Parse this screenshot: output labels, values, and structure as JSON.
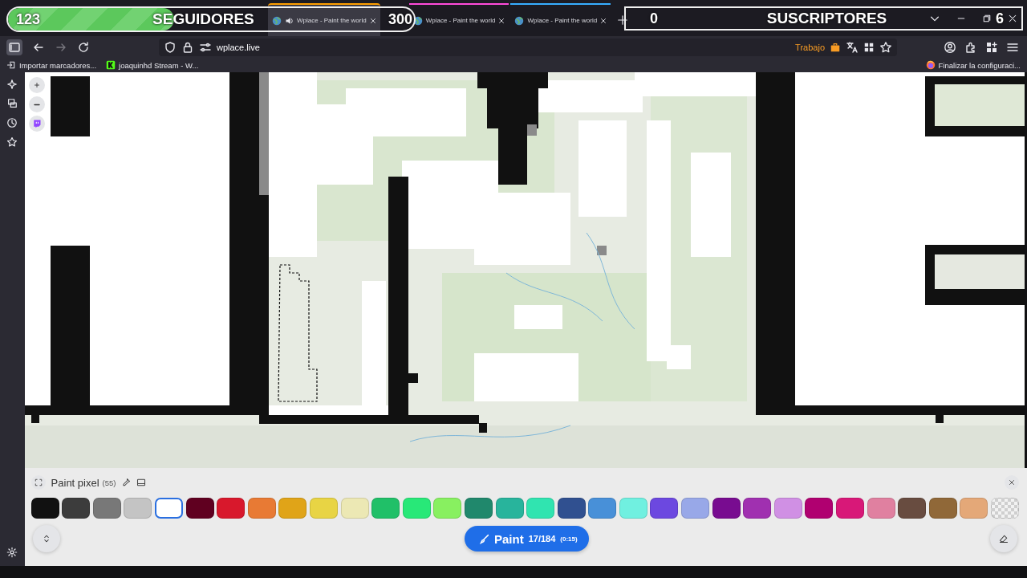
{
  "overlays": {
    "followers": {
      "current": "123",
      "label": "SEGUIDORES",
      "goal": "300",
      "level": 0.41
    },
    "subscribers": {
      "current": "0",
      "label": "SUSCRIPTORES",
      "goal": "6"
    }
  },
  "tabs": [
    {
      "title": "Wplace - Paint the world",
      "selected": true,
      "audio": true,
      "color": "#ff9f00"
    },
    {
      "title": "Wplace - Paint the world",
      "selected": false,
      "audio": false,
      "color": "#ff4bda"
    },
    {
      "title": "Wplace - Paint the world",
      "selected": false,
      "audio": false,
      "color": "#37adff"
    }
  ],
  "navbar": {
    "url": "wplace.live",
    "container": "Trabajo"
  },
  "bookmarks": [
    {
      "label": "Importar marcadores...",
      "kind": "import"
    },
    {
      "label": "joaquinhd Stream - W...",
      "kind": "site"
    }
  ],
  "bookmarks_right": {
    "label": "Finalizar la configuraci..."
  },
  "paint_panel": {
    "title": "Paint pixel",
    "count": "(55)",
    "colors": [
      {
        "color": "#111111",
        "selected": false
      },
      {
        "color": "#3c3c3c",
        "selected": false
      },
      {
        "color": "#787878",
        "selected": false
      },
      {
        "color": "#c4c4c4",
        "selected": false
      },
      {
        "color": "#ffffff",
        "selected": true
      },
      {
        "color": "#600020",
        "selected": false
      },
      {
        "color": "#d8182c",
        "selected": false
      },
      {
        "color": "#e87a34",
        "selected": false
      },
      {
        "color": "#e0a418",
        "selected": false
      },
      {
        "color": "#e8d444",
        "selected": false
      },
      {
        "color": "#ece8b4",
        "selected": false
      },
      {
        "color": "#20c068",
        "selected": false
      },
      {
        "color": "#28e878",
        "selected": false
      },
      {
        "color": "#88f060",
        "selected": false
      },
      {
        "color": "#20886c",
        "selected": false
      },
      {
        "color": "#28b49c",
        "selected": false
      },
      {
        "color": "#30e4b0",
        "selected": false
      },
      {
        "color": "#305090",
        "selected": false
      },
      {
        "color": "#4890d8",
        "selected": false
      },
      {
        "color": "#70f0e0",
        "selected": false
      },
      {
        "color": "#6c48e0",
        "selected": false
      },
      {
        "color": "#98a8e8",
        "selected": false
      },
      {
        "color": "#780c90",
        "selected": false
      },
      {
        "color": "#a030b0",
        "selected": false
      },
      {
        "color": "#d090e4",
        "selected": false
      },
      {
        "color": "#b00070",
        "selected": false
      },
      {
        "color": "#d81878",
        "selected": false
      },
      {
        "color": "#e080a0",
        "selected": false
      },
      {
        "color": "#684c40",
        "selected": false
      },
      {
        "color": "#906838",
        "selected": false
      },
      {
        "color": "#e4a878",
        "selected": false
      },
      {
        "kind": "transparent",
        "selected": false
      }
    ],
    "button": {
      "label": "Paint",
      "charges": "17/184",
      "cooldown": "(0:15)"
    }
  }
}
